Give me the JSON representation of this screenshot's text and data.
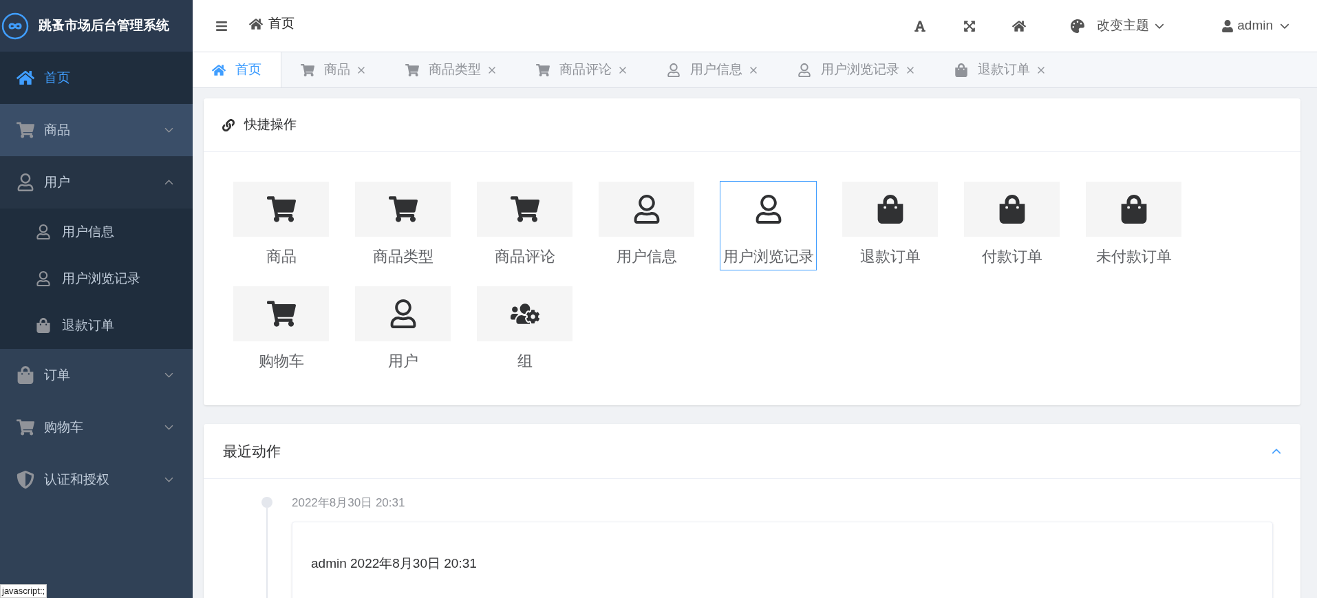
{
  "app": {
    "title": "跳蚤市场后台管理系统"
  },
  "sidebar": {
    "items": [
      {
        "label": "首页",
        "kind": "home",
        "selected": true
      },
      {
        "label": "商品",
        "kind": "cart",
        "selected": false,
        "hovered": true,
        "expanded": false
      },
      {
        "label": "用户",
        "kind": "user",
        "selected": false,
        "hovered": false,
        "expanded": true,
        "children": [
          {
            "label": "用户信息",
            "kind": "user",
            "selected": false
          },
          {
            "label": "用户浏览记录",
            "kind": "user",
            "selected": false
          },
          {
            "label": "退款订单",
            "kind": "bag",
            "selected": false
          }
        ]
      },
      {
        "label": "订单",
        "kind": "bag",
        "selected": false,
        "hovered": false,
        "expanded": false
      },
      {
        "label": "购物车",
        "kind": "cart",
        "selected": false,
        "hovered": false,
        "expanded": false
      },
      {
        "label": "认证和授权",
        "kind": "shield",
        "selected": false,
        "hovered": false,
        "expanded": false
      }
    ]
  },
  "header": {
    "breadcrumb": "首页",
    "theme_menu": "改变主题",
    "user_menu": "admin"
  },
  "tabs": [
    {
      "label": "首页",
      "kind": "home",
      "selected": true,
      "closable": false
    },
    {
      "label": "商品",
      "kind": "cart",
      "selected": false,
      "closable": true
    },
    {
      "label": "商品类型",
      "kind": "cart",
      "selected": false,
      "closable": true
    },
    {
      "label": "商品评论",
      "kind": "cart",
      "selected": false,
      "closable": true
    },
    {
      "label": "用户信息",
      "kind": "user",
      "selected": false,
      "closable": true
    },
    {
      "label": "用户浏览记录",
      "kind": "user",
      "selected": false,
      "closable": true
    },
    {
      "label": "退款订单",
      "kind": "bag",
      "selected": false,
      "closable": true
    }
  ],
  "quick_actions": {
    "title": "快捷操作",
    "tiles": [
      {
        "label": "商品",
        "kind": "cart",
        "selected": false
      },
      {
        "label": "商品类型",
        "kind": "cart",
        "selected": false
      },
      {
        "label": "商品评论",
        "kind": "cart",
        "selected": false
      },
      {
        "label": "用户信息",
        "kind": "user",
        "selected": false
      },
      {
        "label": "用户浏览记录",
        "kind": "user",
        "selected": true
      },
      {
        "label": "退款订单",
        "kind": "bag",
        "selected": false
      },
      {
        "label": "付款订单",
        "kind": "bag",
        "selected": false
      },
      {
        "label": "未付款订单",
        "kind": "bag",
        "selected": false
      },
      {
        "label": "购物车",
        "kind": "cart",
        "selected": false
      },
      {
        "label": "用户",
        "kind": "user",
        "selected": false
      },
      {
        "label": "组",
        "kind": "group",
        "selected": false
      }
    ]
  },
  "recent_actions": {
    "title": "最近动作",
    "expanded": true,
    "timeline": [
      {
        "time": "2022年8月30日 20:31",
        "entry": "admin 2022年8月30日 20:31"
      }
    ]
  },
  "status_tip": "javascript:;"
}
